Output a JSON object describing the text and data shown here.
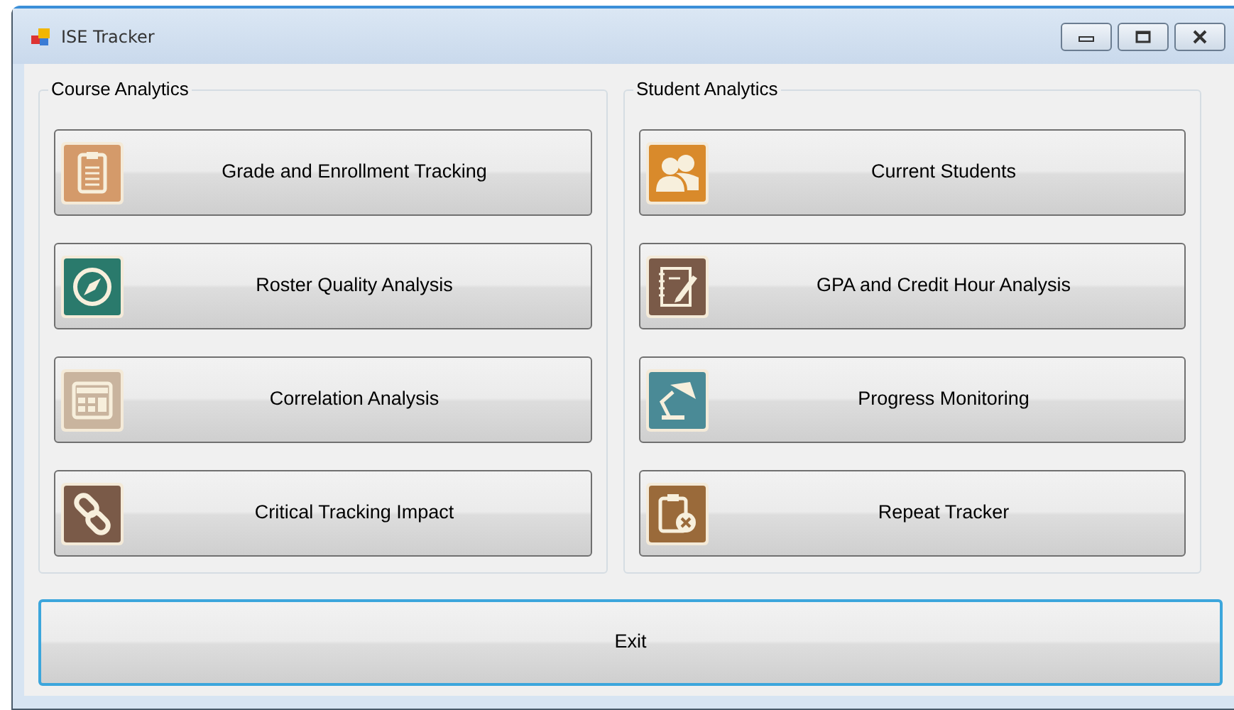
{
  "window": {
    "title": "ISE Tracker"
  },
  "groups": [
    {
      "label": "Course Analytics",
      "buttons": [
        {
          "label": "Grade and Enrollment Tracking",
          "color": "#d49a6a"
        },
        {
          "label": "Roster Quality Analysis",
          "color": "#2a7a6c"
        },
        {
          "label": "Correlation Analysis",
          "color": "#c9b49e"
        },
        {
          "label": "Critical Tracking Impact",
          "color": "#7a5a48"
        }
      ]
    },
    {
      "label": "Student Analytics",
      "buttons": [
        {
          "label": "Current Students",
          "color": "#d98a2b"
        },
        {
          "label": "GPA and Credit Hour Analysis",
          "color": "#7a5a48"
        },
        {
          "label": "Progress Monitoring",
          "color": "#4a8a96"
        },
        {
          "label": "Repeat Tracker",
          "color": "#9a6a3a"
        }
      ]
    }
  ],
  "exit_button": {
    "label": "Exit",
    "focused": true
  }
}
